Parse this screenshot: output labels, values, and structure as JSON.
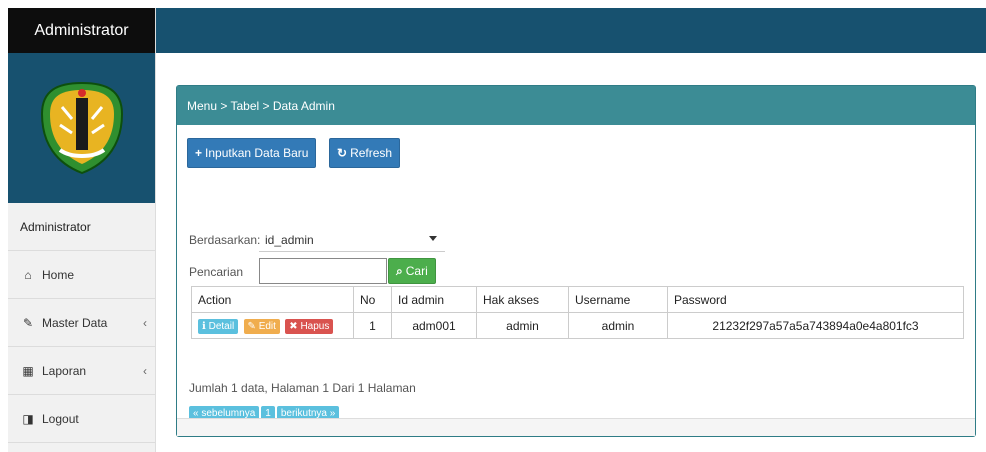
{
  "sidebar": {
    "title": "Administrator",
    "user": "Administrator",
    "items": [
      {
        "label": "Home",
        "icon": "home-icon"
      },
      {
        "label": "Master Data",
        "icon": "edit-icon"
      },
      {
        "label": "Laporan",
        "icon": "calendar-icon"
      },
      {
        "label": "Logout",
        "icon": "logout-icon"
      }
    ]
  },
  "panel": {
    "breadcrumb": "Menu > Tabel > Data Admin",
    "buttons": {
      "add": "Inputkan Data Baru",
      "refresh": "Refresh",
      "search": "Cari"
    },
    "filter": {
      "by_label": "Berdasarkan:",
      "by_value": "id_admin",
      "search_label": "Pencarian"
    },
    "table": {
      "headers": [
        "Action",
        "No",
        "Id admin",
        "Hak akses",
        "Username",
        "Password"
      ],
      "row": {
        "detail": "Detail",
        "edit": "Edit",
        "hapus": "Hapus",
        "no": "1",
        "id_admin": "adm001",
        "hak_akses": "admin",
        "username": "admin",
        "password": "21232f297a57a5a743894a0e4a801fc3"
      }
    },
    "summary": "Jumlah 1 data, Halaman 1 Dari 1 Halaman",
    "pager": {
      "prev": "« sebelumnya",
      "page": "1",
      "next": "berikutnya »"
    }
  }
}
